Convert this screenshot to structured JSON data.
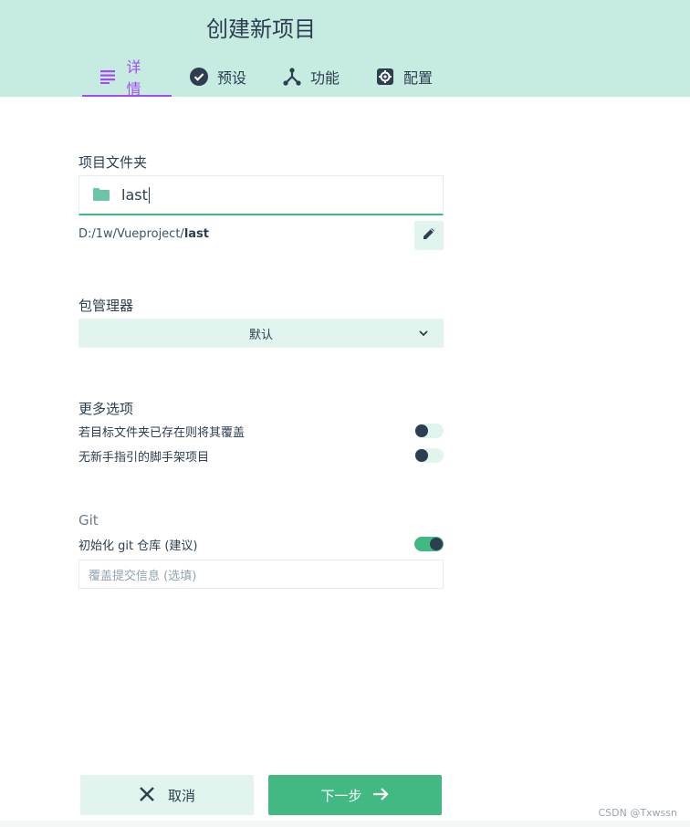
{
  "header": {
    "title": "创建新项目",
    "tabs": [
      {
        "label": "详情",
        "icon": "details-list-icon",
        "active": true
      },
      {
        "label": "预设",
        "icon": "check-circle-icon",
        "active": false
      },
      {
        "label": "功能",
        "icon": "fork-icon",
        "active": false
      },
      {
        "label": "配置",
        "icon": "settings-gear-icon",
        "active": false
      }
    ]
  },
  "folder": {
    "label": "项目文件夹",
    "value": "last",
    "path_prefix": "D:/1w/Vueproject/",
    "path_name": "last"
  },
  "package_manager": {
    "label": "包管理器",
    "selected": "默认"
  },
  "more_options": {
    "label": "更多选项",
    "items": [
      {
        "label": "若目标文件夹已存在则将其覆盖",
        "enabled": false
      },
      {
        "label": "无新手指引的脚手架项目",
        "enabled": false
      }
    ]
  },
  "git": {
    "label": "Git",
    "init_label": "初始化 git 仓库 (建议)",
    "init_enabled": true,
    "commit_placeholder": "覆盖提交信息 (选填)"
  },
  "actions": {
    "cancel_label": "取消",
    "next_label": "下一步"
  },
  "watermark": "CSDN @Txwssn",
  "colors": {
    "header_bg": "#c6ebe1",
    "accent_purple": "#a44cf1",
    "accent_green": "#42b983",
    "light_green": "#e1f5ee",
    "text_dark": "#2c3e50"
  }
}
